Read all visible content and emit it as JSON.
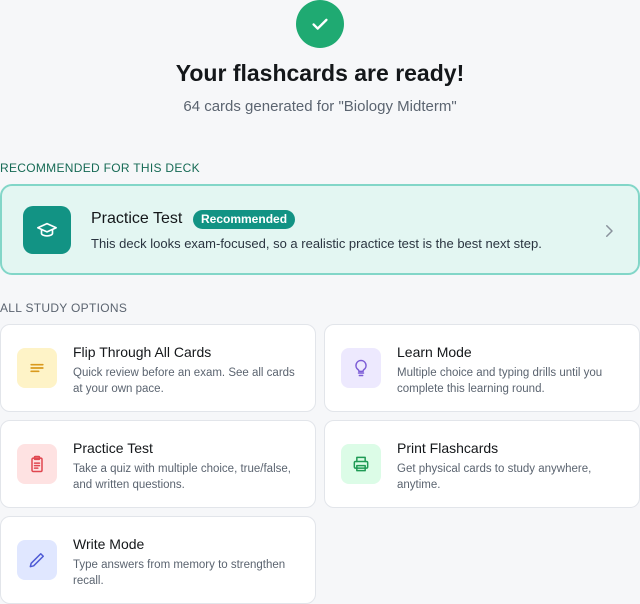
{
  "header": {
    "title": "Your flashcards are ready!",
    "subtitle": "64 cards generated for \"Biology Midterm\""
  },
  "recommended": {
    "section_label": "RECOMMENDED FOR THIS DECK",
    "title": "Practice Test",
    "badge": "Recommended",
    "description": "This deck looks exam-focused, so a realistic practice test is the best next step.",
    "icon": "graduation-cap-icon"
  },
  "all_options": {
    "section_label": "ALL STUDY OPTIONS",
    "items": [
      {
        "title": "Flip Through All Cards",
        "description": "Quick review before an exam. See all cards at your own pace.",
        "icon": "document-lines-icon",
        "icon_bg": "#fef3c7",
        "icon_color": "#d99a1e"
      },
      {
        "title": "Learn Mode",
        "description": "Multiple choice and typing drills until you complete this learning round.",
        "icon": "lightbulb-icon",
        "icon_bg": "#ede9fe",
        "icon_color": "#7c5cd6"
      },
      {
        "title": "Practice Test",
        "description": "Take a quiz with multiple choice, true/false, and written questions.",
        "icon": "clipboard-icon",
        "icon_bg": "#fee2e2",
        "icon_color": "#e0464f"
      },
      {
        "title": "Print Flashcards",
        "description": "Get physical cards to study anywhere, anytime.",
        "icon": "printer-icon",
        "icon_bg": "#dcfce7",
        "icon_color": "#1f9a55"
      },
      {
        "title": "Write Mode",
        "description": "Type answers from memory to strengthen recall.",
        "icon": "pencil-icon",
        "icon_bg": "#e0e7ff",
        "icon_color": "#4f5bd5"
      }
    ]
  },
  "colors": {
    "success": "#1faa72",
    "accent": "#129384",
    "recommended_bg": "#e3f6f2",
    "recommended_border": "#82d6c8"
  }
}
